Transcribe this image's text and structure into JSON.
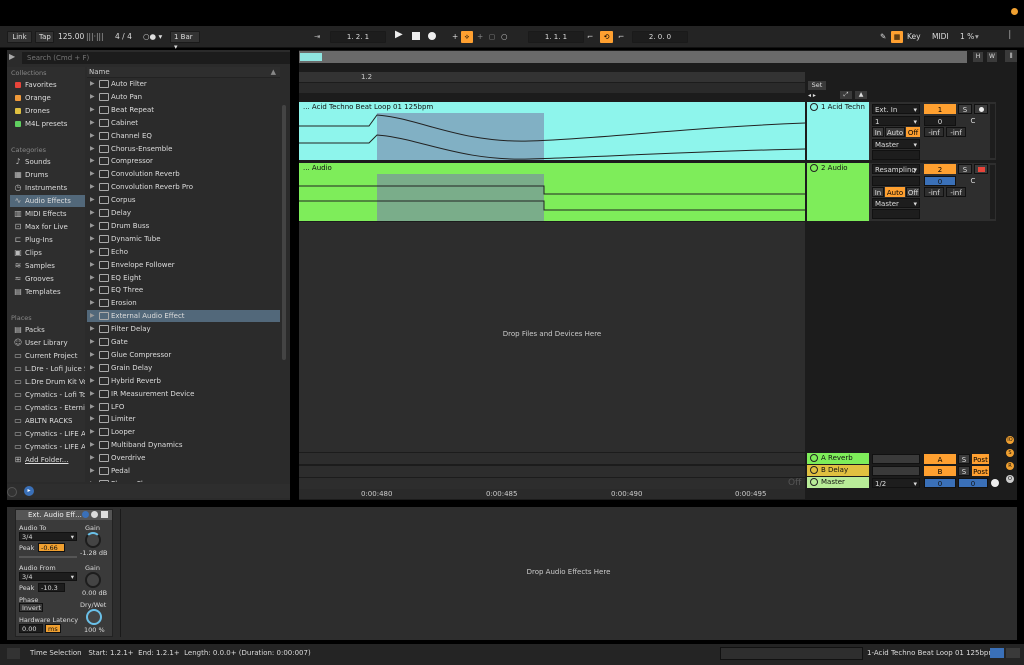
{
  "control_bar": {
    "link": "Link",
    "tap": "Tap",
    "tempo": "125.00",
    "meter": "4 / 4",
    "quantize": "1 Bar",
    "arrangement_position": "1.  2.  1",
    "loop_start": "1.  1.  1",
    "loop_length": "2.  0.  0",
    "key_label": "Key",
    "midi_label": "MIDI",
    "cpu": "1 %"
  },
  "browser": {
    "search_placeholder": "Search (Cmd + F)",
    "collections_header": "Collections",
    "collections": [
      {
        "label": "Favorites",
        "color": "#e8443a"
      },
      {
        "label": "Orange",
        "color": "#f09a3a"
      },
      {
        "label": "Drones",
        "color": "#e0c040"
      },
      {
        "label": "M4L presets",
        "color": "#60d060"
      }
    ],
    "categories_header": "Categories",
    "categories": [
      "Sounds",
      "Drums",
      "Instruments",
      "Audio Effects",
      "MIDI Effects",
      "Max for Live",
      "Plug-Ins",
      "Clips",
      "Samples",
      "Grooves",
      "Templates"
    ],
    "places_header": "Places",
    "places": [
      "Packs",
      "User Library",
      "Current Project",
      "L.Dre - Lofi Juice S",
      "L.Dre Drum Kit Vo",
      "Cymatics - Lofi To",
      "Cymatics - Eternit",
      "ABLTN RACKS",
      "Cymatics - LIFE Ar",
      "Cymatics - LIFE Ar",
      "Add Folder..."
    ],
    "name_header": "Name",
    "items": [
      "Auto Filter",
      "Auto Pan",
      "Beat Repeat",
      "Cabinet",
      "Channel EQ",
      "Chorus-Ensemble",
      "Compressor",
      "Convolution Reverb",
      "Convolution Reverb Pro",
      "Corpus",
      "Delay",
      "Drum Buss",
      "Dynamic Tube",
      "Echo",
      "Envelope Follower",
      "EQ Eight",
      "EQ Three",
      "Erosion",
      "External Audio Effect",
      "Filter Delay",
      "Gate",
      "Glue Compressor",
      "Grain Delay",
      "Hybrid Reverb",
      "IR Measurement Device",
      "LFO",
      "Limiter",
      "Looper",
      "Multiband Dynamics",
      "Overdrive",
      "Pedal",
      "Phaser-Flanger"
    ],
    "selected_item": "External Audio Effect"
  },
  "arrangement": {
    "ruler_mark": "1.2",
    "set_label": "Set",
    "drop_text": "Drop Files and Devices Here",
    "off_label": "Off",
    "time_labels": [
      "0:00:480",
      "0:00:485",
      "0:00:490",
      "0:00:495"
    ],
    "tracks": [
      {
        "clip": "... Acid Techno Beat Loop 01 125bpm",
        "name": "1 Acid Techn",
        "input": "Ext. In",
        "channel": "1",
        "monitor": [
          "In",
          "Auto",
          "Off"
        ],
        "number": "1",
        "solo": "S",
        "vol": "-inf",
        "send": "-inf",
        "pan": "0",
        "c": "C"
      },
      {
        "clip": "... Audio",
        "name": "2 Audio",
        "input": "Resampling",
        "channel": "",
        "monitor": [
          "In",
          "Auto",
          "Off"
        ],
        "number": "2",
        "solo": "S",
        "vol": "-inf",
        "send": "-inf",
        "pan": "0",
        "c": "C"
      }
    ],
    "output": "Master",
    "returns": [
      {
        "name": "A Reverb",
        "letter": "A",
        "solo": "S",
        "post": "Post"
      },
      {
        "name": "B Delay",
        "letter": "B",
        "solo": "S",
        "post": "Post"
      }
    ],
    "master": {
      "name": "Master",
      "cue": "1/2",
      "a": "0",
      "b": "0"
    }
  },
  "device": {
    "title": "Ext. Audio Eff...",
    "audio_to_label": "Audio To",
    "audio_to": "3/4",
    "peak_label": "Peak",
    "peak_to": "-0.66",
    "gain_label": "Gain",
    "gain_to": "-1.28 dB",
    "audio_from_label": "Audio From",
    "audio_from": "3/4",
    "peak_from": "-10.3",
    "gain_from": "0.00 dB",
    "phase_label": "Phase",
    "invert": "Invert",
    "drywet_label": "Dry/Wet",
    "drywet": "100 %",
    "latency_label": "Hardware Latency",
    "latency": "0.00",
    "latency_unit": "ms",
    "drop_text": "Drop Audio Effects Here"
  },
  "status": {
    "selection": "Time Selection",
    "start": "Start: 1.2.1+",
    "end": "End: 1.2.1+",
    "length": "Length: 0.0.0+ (Duration: 0:00:007)",
    "clip_name": "1-Acid Techno Beat Loop 01 125bpm"
  },
  "colors": {
    "accent": "#ffa030",
    "track1": "#8ef5ec",
    "track2": "#7eed5a",
    "selection": "#52687a"
  }
}
